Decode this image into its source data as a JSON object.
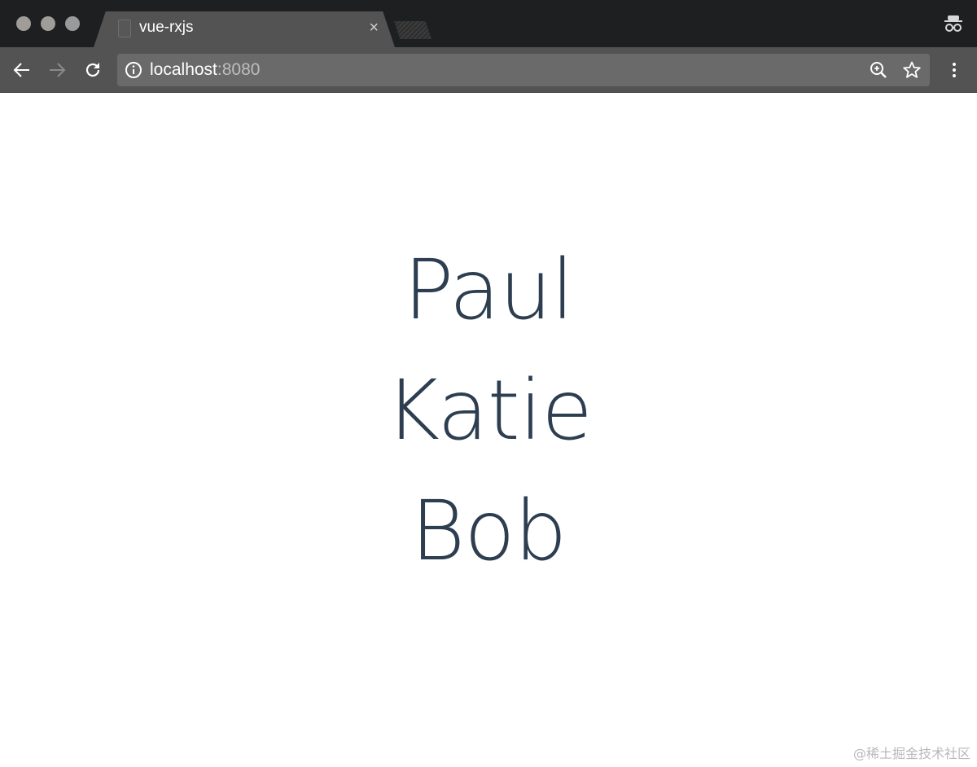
{
  "browser": {
    "tab_title": "vue-rxjs",
    "tab_close": "×",
    "url_host": "localhost",
    "url_port": ":8080"
  },
  "icons": {
    "back": "arrow-left-icon",
    "forward": "arrow-right-icon",
    "reload": "reload-icon",
    "info": "info-icon",
    "zoom": "zoom-in-icon",
    "bookmark": "star-icon",
    "menu": "more-vertical-icon",
    "incognito": "incognito-icon"
  },
  "content": {
    "names": [
      "Paul",
      "Katie",
      "Bob"
    ]
  },
  "watermark": "@稀土掘金技术社区",
  "colors": {
    "name_text": "#2c3e50",
    "chrome_dark": "#1d1f21",
    "chrome_toolbar": "#535353"
  }
}
